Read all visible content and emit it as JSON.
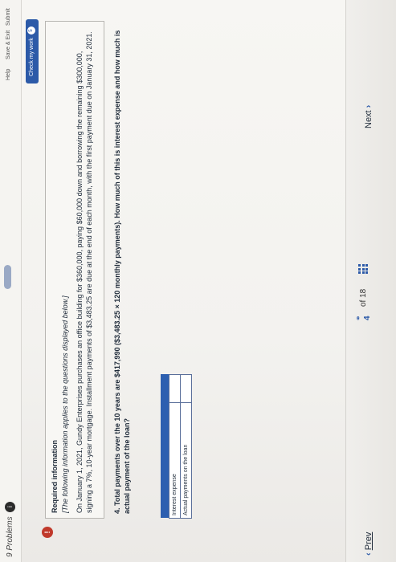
{
  "header": {
    "problems_label": "9 Problems",
    "problems_badge": "i",
    "help": "Help",
    "save_exit": "Save & Exit",
    "submit": "Submit",
    "check_label": "Check my work",
    "check_count": "5"
  },
  "info": {
    "alert_icon": "!",
    "title": "Required information",
    "italic_note": "[The following information applies to the questions displayed below.]",
    "body": "On January 1, 2021, Gundy Enterprises purchases an office building for $360,000, paying $60,000 down and borrowing the remaining $300,000, signing a 7%, 10-year mortgage. Installment payments of $3,483.25 are due at the end of each month, with the first payment due on January 31, 2021."
  },
  "question": {
    "text": "4. Total payments over the 10 years are $417,990 ($3,483.25 × 120 monthly payments). How much of this is interest expense and how much is actual payment of the loan?"
  },
  "answer_table": {
    "rows": [
      {
        "label": "Interest expense",
        "value": ""
      },
      {
        "label": "Actual payments on the loan",
        "value": ""
      }
    ]
  },
  "footer": {
    "prev": "Prev",
    "page_current": "4",
    "page_of": "of 18",
    "next": "Next"
  },
  "icons": {
    "prev": "chevron-left-icon",
    "next": "chevron-right-icon",
    "grid": "grid-icon",
    "link": "link-icon"
  },
  "colors": {
    "accent": "#2c5aa8",
    "alert": "#c0392b",
    "table_header": "#2d5fb0"
  }
}
